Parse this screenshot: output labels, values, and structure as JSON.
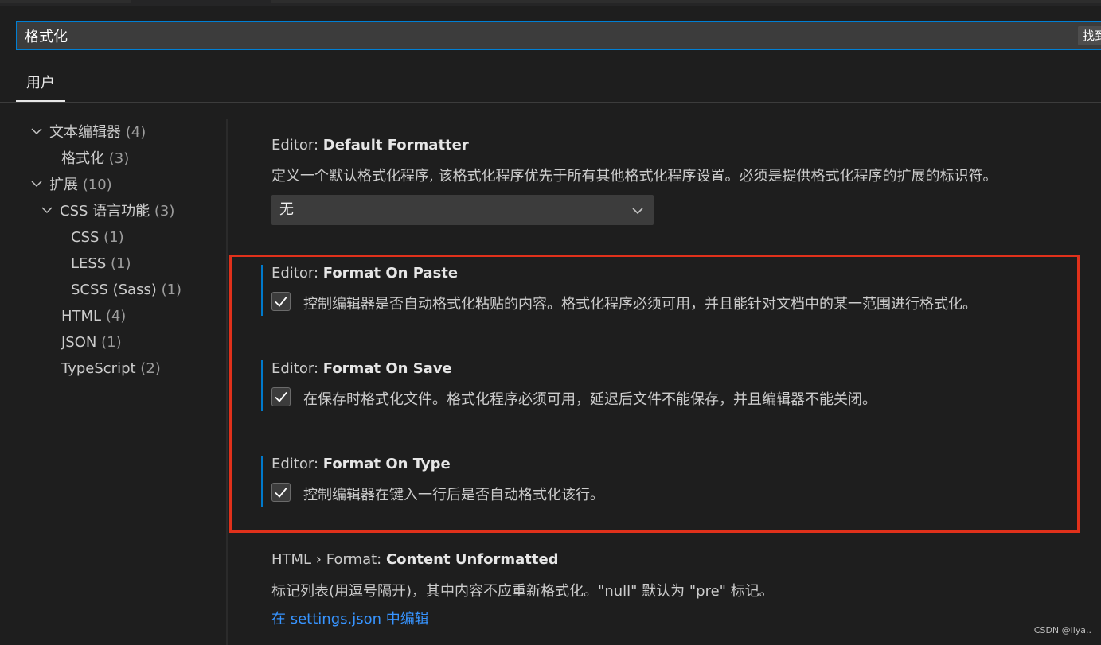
{
  "search": {
    "value": "格式化",
    "result_count": "找到"
  },
  "tabs": {
    "user": "用户"
  },
  "toc": [
    {
      "label": "文本编辑器",
      "count": "(4)"
    },
    {
      "label": "格式化",
      "count": "(3)"
    },
    {
      "label": "扩展",
      "count": "(10)"
    },
    {
      "label": "CSS 语言功能",
      "count": "(3)"
    },
    {
      "label": "CSS",
      "count": "(1)"
    },
    {
      "label": "LESS",
      "count": "(1)"
    },
    {
      "label": "SCSS (Sass)",
      "count": "(1)"
    },
    {
      "label": "HTML",
      "count": "(4)"
    },
    {
      "label": "JSON",
      "count": "(1)"
    },
    {
      "label": "TypeScript",
      "count": "(2)"
    }
  ],
  "settings": {
    "default_formatter": {
      "category": "Editor: ",
      "name": "Default Formatter",
      "description": "定义一个默认格式化程序, 该格式化程序优先于所有其他格式化程序设置。必须是提供格式化程序的扩展的标识符。",
      "selected": "无"
    },
    "format_on_paste": {
      "category": "Editor: ",
      "name": "Format On Paste",
      "description": "控制编辑器是否自动格式化粘贴的内容。格式化程序必须可用，并且能针对文档中的某一范围进行格式化。",
      "checked": true
    },
    "format_on_save": {
      "category": "Editor: ",
      "name": "Format On Save",
      "description": "在保存时格式化文件。格式化程序必须可用，延迟后文件不能保存，并且编辑器不能关闭。",
      "checked": true
    },
    "format_on_type": {
      "category": "Editor: ",
      "name": "Format On Type",
      "description": "控制编辑器在键入一行后是否自动格式化该行。",
      "checked": true
    },
    "content_unformatted": {
      "category": "HTML › Format: ",
      "name": "Content Unformatted",
      "description": "标记列表(用逗号隔开)，其中内容不应重新格式化。\"null\" 默认为 \"pre\" 标记。",
      "link": "在 settings.json 中编辑"
    }
  },
  "watermark": "CSDN @liya..",
  "colors": {
    "accent": "#007acc",
    "highlight_border": "#e0311b",
    "link": "#3794ff",
    "background": "#1e1e1e"
  }
}
